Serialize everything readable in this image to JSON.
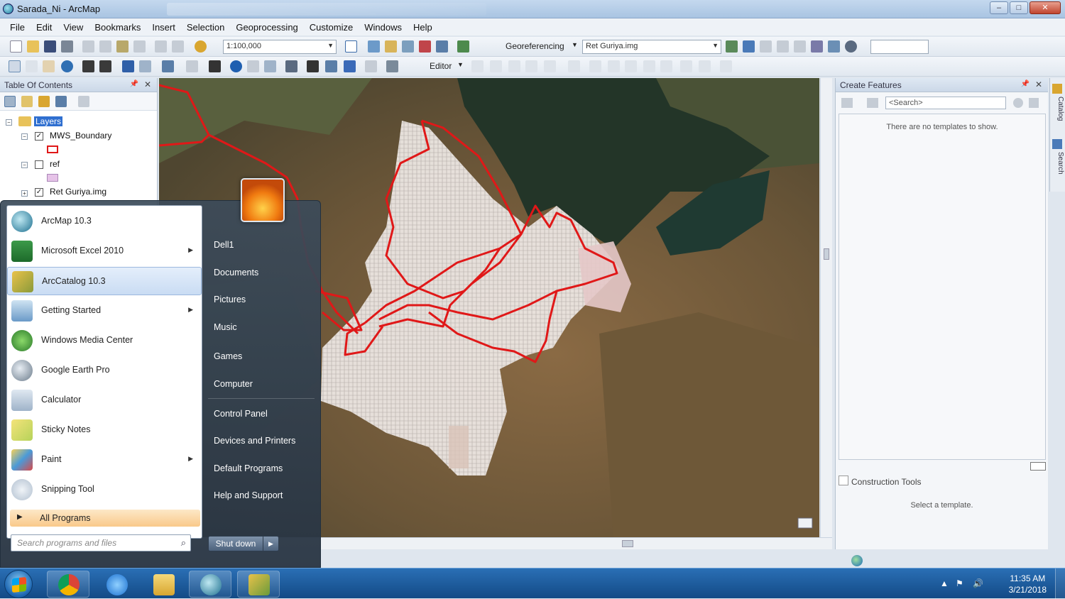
{
  "window": {
    "title": "Sarada_Ni - ArcMap"
  },
  "menu": [
    "File",
    "Edit",
    "View",
    "Bookmarks",
    "Insert",
    "Selection",
    "Geoprocessing",
    "Customize",
    "Windows",
    "Help"
  ],
  "toolbar": {
    "scale": "1:100,000",
    "georeferencing_label": "Georeferencing",
    "georef_layer": "Ret Guriya.img",
    "editor_label": "Editor"
  },
  "toc": {
    "title": "Table Of Contents",
    "root": "Layers",
    "layers": [
      {
        "name": "MWS_Boundary",
        "checked": true
      },
      {
        "name": "ref",
        "checked": false
      },
      {
        "name": "Ret Guriya.img",
        "checked": true
      }
    ]
  },
  "create_features": {
    "title": "Create Features",
    "search_placeholder": "<Search>",
    "no_templates": "There are no templates to show.",
    "construction_tools": "Construction Tools",
    "select_template": "Select a template."
  },
  "side_tabs": [
    "Catalog",
    "Search"
  ],
  "start_menu": {
    "programs": [
      {
        "label": "ArcMap 10.3",
        "icon": "arcmap-icon",
        "submenu": false
      },
      {
        "label": "Microsoft Excel 2010",
        "icon": "excel-icon",
        "submenu": true
      },
      {
        "label": "ArcCatalog 10.3",
        "icon": "arccatalog-icon",
        "submenu": false,
        "highlighted": true
      },
      {
        "label": "Getting Started",
        "icon": "getting-started-icon",
        "submenu": true
      },
      {
        "label": "Windows Media Center",
        "icon": "media-center-icon",
        "submenu": false
      },
      {
        "label": "Google Earth Pro",
        "icon": "google-earth-icon",
        "submenu": false
      },
      {
        "label": "Calculator",
        "icon": "calculator-icon",
        "submenu": false
      },
      {
        "label": "Sticky Notes",
        "icon": "sticky-notes-icon",
        "submenu": false
      },
      {
        "label": "Paint",
        "icon": "paint-icon",
        "submenu": true
      },
      {
        "label": "Snipping Tool",
        "icon": "snipping-tool-icon",
        "submenu": false
      }
    ],
    "all_programs": "All Programs",
    "search_placeholder": "Search programs and files",
    "right_items": [
      "Dell1",
      "Documents",
      "Pictures",
      "Music",
      "Games",
      "Computer",
      "Control Panel",
      "Devices and Printers",
      "Default Programs",
      "Help and Support"
    ],
    "shutdown": "Shut down"
  },
  "taskbar": {
    "apps": [
      "chrome-icon",
      "internet-explorer-icon",
      "file-explorer-icon",
      "arcmap-icon",
      "arccatalog-icon"
    ],
    "time": "11:35 AM",
    "date": "3/21/2018"
  },
  "colors": {
    "boundary_red": "#e01818",
    "highlight_orange": "#f9c98a",
    "taskbar_blue": "#134a86"
  }
}
